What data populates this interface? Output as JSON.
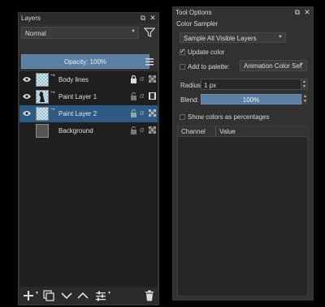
{
  "layers_panel": {
    "title": "Layers",
    "blend_mode": "Normal",
    "opacity_label": "Opacity:",
    "opacity_value": "100%",
    "layers": [
      {
        "name": "Body lines",
        "selected": false
      },
      {
        "name": "Paint Layer 1",
        "selected": false
      },
      {
        "name": "Paint Layer 2",
        "selected": true
      },
      {
        "name": "Background",
        "selected": false
      }
    ],
    "icons": {
      "filter": "filter-icon",
      "menu": "hamburger-icon",
      "add": "plus-icon",
      "duplicate": "duplicate-icon",
      "move_down": "chevron-down-icon",
      "move_up": "chevron-up-icon",
      "properties": "sliders-icon",
      "delete": "trash-icon"
    }
  },
  "tool_options": {
    "title": "Tool Options",
    "tool_name": "Color Sampler",
    "sample_mode": "Sample All Visible Layers",
    "update_color": {
      "label": "Update color",
      "checked": true
    },
    "add_to_palette": {
      "label": "Add to palette:",
      "checked": false,
      "palette": "Animation Color Set"
    },
    "radius": {
      "label": "Radius:",
      "value": "1 px"
    },
    "blend": {
      "label": "Blend:",
      "value": "100%"
    },
    "show_percentages": {
      "label": "Show colors as percentages",
      "checked": false
    },
    "table": {
      "columns": [
        "Channel",
        "Value"
      ]
    }
  },
  "colors": {
    "accent": "#5b7fa3",
    "selection": "#2d5a82",
    "panel": "#313131",
    "background": "#000000"
  }
}
